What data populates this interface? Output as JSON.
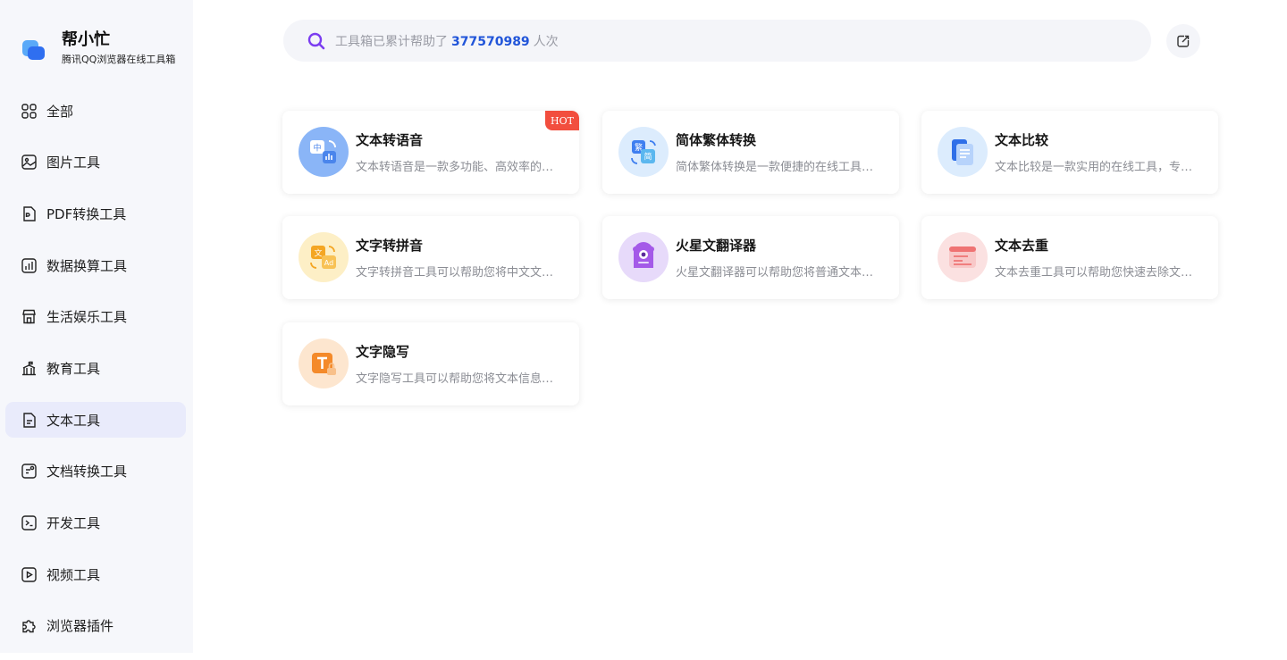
{
  "brand": {
    "title": "帮小忙",
    "subtitle": "腾讯QQ浏览器在线工具箱"
  },
  "sidebar": {
    "items": [
      {
        "label": "全部",
        "icon": "grid-icon",
        "active": false
      },
      {
        "label": "图片工具",
        "icon": "image-icon",
        "active": false
      },
      {
        "label": "PDF转换工具",
        "icon": "pdf-icon",
        "active": false
      },
      {
        "label": "数据换算工具",
        "icon": "chart-icon",
        "active": false
      },
      {
        "label": "生活娱乐工具",
        "icon": "store-icon",
        "active": false
      },
      {
        "label": "教育工具",
        "icon": "school-icon",
        "active": false
      },
      {
        "label": "文本工具",
        "icon": "text-file-icon",
        "active": true
      },
      {
        "label": "文档转换工具",
        "icon": "doc-convert-icon",
        "active": false
      },
      {
        "label": "开发工具",
        "icon": "terminal-icon",
        "active": false
      },
      {
        "label": "视频工具",
        "icon": "video-icon",
        "active": false
      },
      {
        "label": "浏览器插件",
        "icon": "puzzle-icon",
        "active": false
      }
    ]
  },
  "search": {
    "prefix": "工具箱已累计帮助了",
    "count": "377570989",
    "suffix": "人次"
  },
  "share": {
    "icon": "share-icon"
  },
  "tools": [
    {
      "title": "文本转语音",
      "desc": "文本转语音是一款多功能、高效率的在线工具",
      "icon": "text-to-speech-icon",
      "bg": "#8ab5f7",
      "badge": "HOT"
    },
    {
      "title": "简体繁体转换",
      "desc": "简体繁体转换是一款便捷的在线工具，可以帮助您",
      "icon": "simplified-traditional-icon",
      "bg": "#dcecfd",
      "badge": ""
    },
    {
      "title": "文本比较",
      "desc": "文本比较是一款实用的在线工具，专门用于比较",
      "icon": "text-compare-icon",
      "bg": "#dcecfd",
      "badge": ""
    },
    {
      "title": "文字转拼音",
      "desc": "文字转拼音工具可以帮助您将中文文字转换为拼音",
      "icon": "text-to-pinyin-icon",
      "bg": "#fdefc6",
      "badge": ""
    },
    {
      "title": "火星文翻译器",
      "desc": "火星文翻译器可以帮助您将普通文本转换为火星文",
      "icon": "martian-translator-icon",
      "bg": "#e7dafa",
      "badge": ""
    },
    {
      "title": "文本去重",
      "desc": "文本去重工具可以帮助您快速去除文本中的重复内容",
      "icon": "text-dedupe-icon",
      "bg": "#fbe1e1",
      "badge": ""
    },
    {
      "title": "文字隐写",
      "desc": "文字隐写工具可以帮助您将文本信息隐藏起来",
      "icon": "text-steganography-icon",
      "bg": "#fde6cf",
      "badge": ""
    }
  ]
}
